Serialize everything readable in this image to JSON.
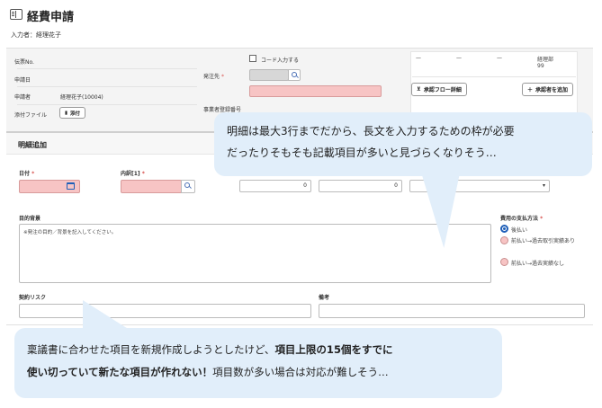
{
  "header": {
    "title": "経費申請",
    "inputter": "入力者：経理花子"
  },
  "form": {
    "slip_no_label": "伝票No.",
    "apply_date_label": "申請日",
    "applicant_label": "申請者",
    "applicant_value": "経理花子(10004)",
    "attachment_label": "添付ファイル",
    "attach_button": "添付",
    "code_checkbox_label": "コード入力する",
    "order_to_label": "発注先",
    "vendor_reg_label": "事業者登録番号"
  },
  "approval": {
    "col1": "—",
    "col2": "—",
    "col3": "—",
    "col4_line1": "経理部",
    "col4_line2": "99",
    "flow_button": "承認フロー詳細",
    "add_approver_button": "承認者を追加"
  },
  "detail": {
    "title": "明細追加",
    "date_label": "日付",
    "breakdown_label": "内訳[1]",
    "amount1_value": "0",
    "amount2_value": "0",
    "purpose_label": "目的背景",
    "purpose_placeholder": "※発注の目的／背景を記入してください。",
    "payment_label": "費用の支払方法",
    "payment_options": [
      "後払い",
      "前払い→過去取引実績あり",
      "前払い→過去実績なし"
    ],
    "risk_label": "契約リスク",
    "note_label": "備考"
  },
  "bubbles": {
    "top_line1": "明細は最大3行までだから、長文を入力するための枠が必要",
    "top_line2": "だったりそもそも記載項目が多いと見づらくなりそう…",
    "bottom_part1": "稟議書に合わせた項目を新規作成しようとしたけど、",
    "bottom_bold1": "項目上限の15個をすでに",
    "bottom_bold2": "使い切っていて新たな項目が作れない！",
    "bottom_part2": "項目数が多い場合は対応が難しそう…"
  },
  "colors": {
    "required_pink": "#f7c4c4",
    "bubble_blue": "#e1eefa",
    "radio_blue": "#1f5fb8"
  }
}
